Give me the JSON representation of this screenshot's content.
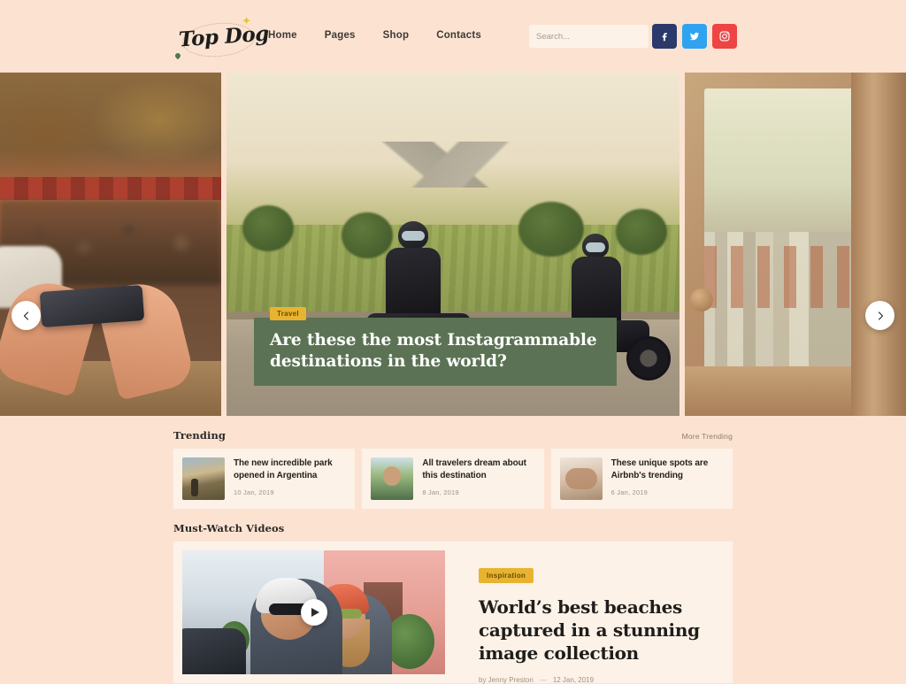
{
  "site": {
    "logo_text": "Top Dog",
    "background_color": "#fce3d1",
    "card_color": "#fdf2e8",
    "accent_yellow": "#e8b430",
    "accent_green": "#5b7354"
  },
  "header": {
    "nav": [
      {
        "label": "Home"
      },
      {
        "label": "Pages"
      },
      {
        "label": "Shop"
      },
      {
        "label": "Contacts"
      }
    ],
    "search": {
      "placeholder": "Search...",
      "value": "",
      "icon": "search-icon"
    },
    "socials": [
      {
        "name": "facebook",
        "glyph": "f",
        "color": "#2b3a6b"
      },
      {
        "name": "twitter",
        "glyph": "t",
        "color": "#2fa3f0"
      },
      {
        "name": "instagram",
        "glyph": "i",
        "color": "#ee4444"
      }
    ]
  },
  "hero": {
    "prev_label": "Previous slide",
    "next_label": "Next slide",
    "slide": {
      "badge": "Travel",
      "title": "Are these the most Instagrammable destinations in the world?"
    }
  },
  "trending": {
    "title": "Trending",
    "more_label": "More Trending",
    "cards": [
      {
        "title": "The new incredible park opened in Argentina",
        "date": "10 Jan, 2019"
      },
      {
        "title": "All travelers dream about this destination",
        "date": "8 Jan, 2019"
      },
      {
        "title": "These unique spots are Airbnb's trending",
        "date": "6 Jan, 2019"
      }
    ]
  },
  "videos": {
    "title": "Must-Watch Videos",
    "featured": {
      "badge": "Inspiration",
      "title": "World’s best beaches captured in a stunning image collection",
      "author": "by Jenny Preston",
      "separator": "—",
      "date": "12 Jan, 2019",
      "play_label": "Play video"
    }
  }
}
